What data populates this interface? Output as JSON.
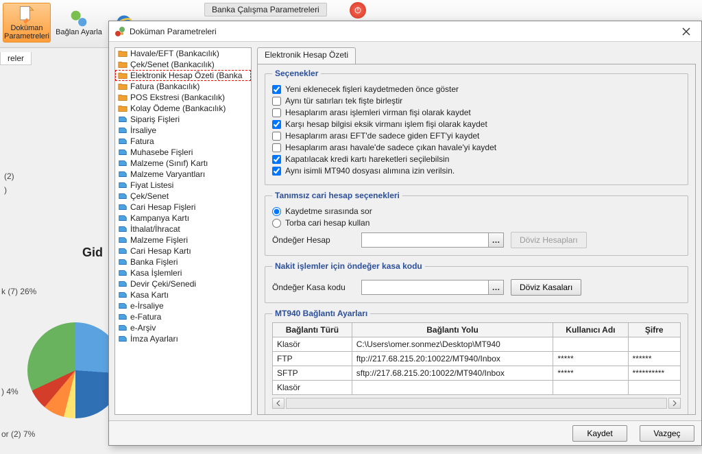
{
  "ribbon": {
    "btnDocParams": "Doküman Parametreleri",
    "btnConnSettings": "Bağlan Ayarla",
    "title": "Banka Çalışma Parametreleri",
    "subtab": "reler"
  },
  "bg": {
    "line1": " (2)",
    "line2": " )",
    "gid": "Gid",
    "slice1": "k (7) 26%",
    "slice2": ") 4%",
    "slice3": "or (2) 7%"
  },
  "dialog": {
    "title": "Doküman Parametreleri"
  },
  "tree": [
    {
      "label": "Havale/EFT (Bankacılık)",
      "icon": "folder"
    },
    {
      "label": "Çek/Senet (Bankacılık)",
      "icon": "folder"
    },
    {
      "label": "Elektronik Hesap Özeti (Banka",
      "icon": "folder",
      "selected": true
    },
    {
      "label": "Fatura (Bankacılık)",
      "icon": "folder"
    },
    {
      "label": "POS Ekstresi (Bankacılık)",
      "icon": "folder"
    },
    {
      "label": "Kolay Ödeme (Bankacılık)",
      "icon": "folder"
    },
    {
      "label": "Sipariş Fişleri",
      "icon": "blue"
    },
    {
      "label": "İrsaliye",
      "icon": "blue"
    },
    {
      "label": "Fatura",
      "icon": "blue"
    },
    {
      "label": "Muhasebe Fişleri",
      "icon": "blue"
    },
    {
      "label": "Malzeme (Sınıf) Kartı",
      "icon": "blue"
    },
    {
      "label": "Malzeme Varyantları",
      "icon": "blue"
    },
    {
      "label": "Fiyat Listesi",
      "icon": "blue"
    },
    {
      "label": "Çek/Senet",
      "icon": "blue"
    },
    {
      "label": "Cari Hesap Fişleri",
      "icon": "blue"
    },
    {
      "label": "Kampanya Kartı",
      "icon": "blue"
    },
    {
      "label": "İthalat/İhracat",
      "icon": "blue"
    },
    {
      "label": "Malzeme Fişleri",
      "icon": "blue"
    },
    {
      "label": "Cari Hesap Kartı",
      "icon": "blue"
    },
    {
      "label": "Banka Fişleri",
      "icon": "blue"
    },
    {
      "label": "Kasa İşlemleri",
      "icon": "blue"
    },
    {
      "label": "Devir Çeki/Senedi",
      "icon": "blue"
    },
    {
      "label": "Kasa Kartı",
      "icon": "blue"
    },
    {
      "label": "e-İrsaliye",
      "icon": "blue"
    },
    {
      "label": "e-Fatura",
      "icon": "blue"
    },
    {
      "label": "e-Arşiv",
      "icon": "blue"
    },
    {
      "label": "İmza Ayarları",
      "icon": "blue"
    }
  ],
  "right": {
    "tab": "Elektronik Hesap Özeti",
    "options": {
      "legend": "Seçenekler",
      "items": [
        {
          "label": "Yeni eklenecek fişleri kaydetmeden önce göster",
          "checked": true
        },
        {
          "label": "Aynı tür satırları tek fişte birleştir",
          "checked": false
        },
        {
          "label": "Hesaplarım arası işlemleri virman fişi olarak kaydet",
          "checked": false
        },
        {
          "label": "Karşı hesap bilgisi eksik virmanı işlem fişi olarak kaydet",
          "checked": true
        },
        {
          "label": "Hesaplarım arası EFT'de sadece giden EFT'yi kaydet",
          "checked": false
        },
        {
          "label": "Hesaplarım arası havale'de sadece çıkan havale'yi kaydet",
          "checked": false
        },
        {
          "label": "Kapatılacak kredi kartı hareketleri seçilebilsin",
          "checked": true
        },
        {
          "label": "Aynı isimli MT940 dosyası alımına izin verilsin.",
          "checked": true
        }
      ]
    },
    "undef": {
      "legend": "Tanımsız cari hesap seçenekleri",
      "radios": [
        {
          "label": "Kaydetme sırasında sor",
          "checked": true
        },
        {
          "label": "Torba cari hesap kullan",
          "checked": false
        }
      ],
      "defaultLabel": "Öndeğer Hesap",
      "btn": "Döviz Hesapları"
    },
    "cash": {
      "legend": "Nakit işlemler için öndeğer kasa kodu",
      "label": "Öndeğer Kasa kodu",
      "btn": "Döviz Kasaları"
    },
    "mt940": {
      "legend": "MT940 Bağlantı Ayarları",
      "headers": [
        "Bağlantı Türü",
        "Bağlantı Yolu",
        "Kullanıcı Adı",
        "Şifre"
      ],
      "rows": [
        [
          "Klasör",
          "C:\\Users\\omer.sonmez\\Desktop\\MT940",
          "",
          ""
        ],
        [
          "FTP",
          "ftp://217.68.215.20:10022/MT940/Inbox",
          "*****",
          "******"
        ],
        [
          "SFTP",
          "sftp://217.68.215.20:10022/MT940/Inbox",
          "*****",
          "**********"
        ],
        [
          "Klasör",
          "",
          "",
          ""
        ]
      ]
    }
  },
  "footer": {
    "save": "Kaydet",
    "cancel": "Vazgeç"
  }
}
